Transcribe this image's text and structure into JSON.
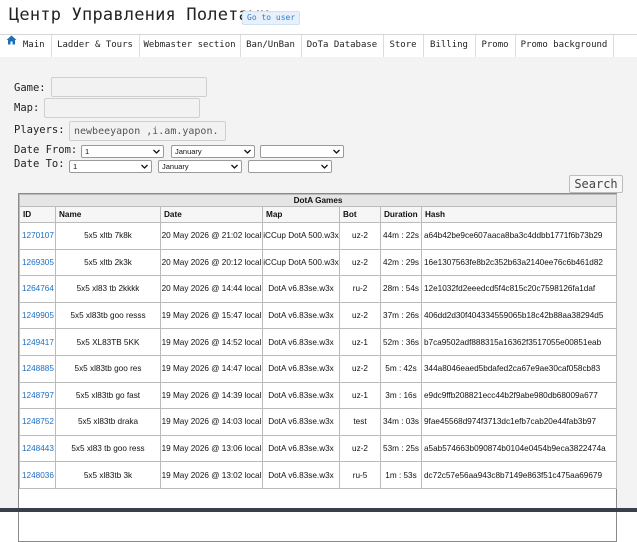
{
  "header": {
    "title": "Центр Управления Полетами",
    "goto_label": "Go to user"
  },
  "nav": [
    {
      "label": "Main"
    },
    {
      "label": "Ladder & Tours"
    },
    {
      "label": "Webmaster section"
    },
    {
      "label": "Ban/UnBan"
    },
    {
      "label": "DoTa Database"
    },
    {
      "label": "Store"
    },
    {
      "label": "Billing"
    },
    {
      "label": "Promo"
    },
    {
      "label": "Promo background"
    }
  ],
  "form": {
    "game_label": "Game:",
    "game_value": "",
    "map_label": "Map:",
    "map_value": "",
    "players_label": "Players:",
    "players_value": "newbeeyapon ,i.am.yapon.",
    "date_from_label": "Date From:",
    "date_to_label": "Date To:",
    "date_from": {
      "day": "1",
      "month": "January",
      "year": ""
    },
    "date_to": {
      "day": "1",
      "month": "January",
      "year": ""
    },
    "search_label": "Search"
  },
  "table": {
    "caption": "DotA Games",
    "columns": [
      "ID",
      "Name",
      "Date",
      "Map",
      "Bot",
      "Duration",
      "Hash"
    ],
    "rows": [
      {
        "id": "1270107",
        "name": "5x5 xltb 7k8k",
        "date": "20 May 2026 @ 21:02 local",
        "map": "iCCup DotA 500.w3x",
        "bot": "uz-2",
        "duration": "44m : 22s",
        "hash": "a64b42be9ce607aaca8ba3c4ddbb1771f6b73b29"
      },
      {
        "id": "1269305",
        "name": "5x5 xltb 2k3k",
        "date": "20 May 2026 @ 20:12 local",
        "map": "iCCup DotA 500.w3x",
        "bot": "uz-2",
        "duration": "42m : 29s",
        "hash": "16e1307563fe8b2c352b63a2140ee76c6b461d82"
      },
      {
        "id": "1264764",
        "name": "5x5 xl83 tb 2kkkk",
        "date": "20 May 2026 @ 14:44 local",
        "map": "DotA v6.83se.w3x",
        "bot": "ru-2",
        "duration": "28m : 54s",
        "hash": "12e1032fd2eeedcd5f4c815c20c7598126fa1daf"
      },
      {
        "id": "1249905",
        "name": "5x5 xl83tb goo resss",
        "date": "19 May 2026 @ 15:47 local",
        "map": "DotA v6.83se.w3x",
        "bot": "uz-2",
        "duration": "37m : 26s",
        "hash": "406dd2d30f404334559065b18c42b88aa38294d5"
      },
      {
        "id": "1249417",
        "name": "5x5 XL83TB 5KK",
        "date": "19 May 2026 @ 14:52 local",
        "map": "DotA v6.83se.w3x",
        "bot": "uz-1",
        "duration": "52m : 36s",
        "hash": "b7ca9502adf888315a16362f3517055e00851eab"
      },
      {
        "id": "1248885",
        "name": "5x5 xl83tb goo res",
        "date": "19 May 2026 @ 14:47 local",
        "map": "DotA v6.83se.w3x",
        "bot": "uz-2",
        "duration": "5m : 42s",
        "hash": "344a8046eaed5bdafed2ca67e9ae30caf058cb83"
      },
      {
        "id": "1248797",
        "name": "5x5 xl83tb go fast",
        "date": "19 May 2026 @ 14:39 local",
        "map": "DotA v6.83se.w3x",
        "bot": "uz-1",
        "duration": "3m : 16s",
        "hash": "e9dc9ffb208821ecc44b2f9abe980db68009a677"
      },
      {
        "id": "1248752",
        "name": "5x5 xl83tb draka",
        "date": "19 May 2026 @ 14:03 local",
        "map": "DotA v6.83se.w3x",
        "bot": "test",
        "duration": "34m : 03s",
        "hash": "9fae45568d974f3713dc1efb7cab20e44fab3b97"
      },
      {
        "id": "1248443",
        "name": "5x5 xl83 tb goo ress",
        "date": "19 May 2026 @ 13:06 local",
        "map": "DotA v6.83se.w3x",
        "bot": "uz-2",
        "duration": "53m : 25s",
        "hash": "a5ab574663b090874b0104e0454b9eca3822474a"
      },
      {
        "id": "1248036",
        "name": "5x5 xl83tb 3k",
        "date": "19 May 2026 @ 13:02 local",
        "map": "DotA v6.83se.w3x",
        "bot": "ru-5",
        "duration": "1m : 53s",
        "hash": "dc72c57e56aa943c8b7149e863f51c475aa69679"
      }
    ]
  },
  "colors": {
    "link": "#1a6fc4",
    "home_icon": "#1f6fb8",
    "badge": "#2a7fd0"
  }
}
